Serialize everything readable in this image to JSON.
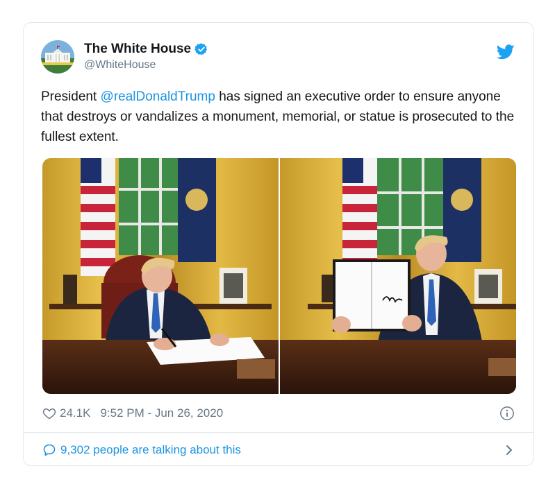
{
  "author": {
    "display_name": "The White House",
    "handle": "@WhiteHouse"
  },
  "tweet": {
    "text_before": "President ",
    "mention": "@realDonaldTrump",
    "text_after": " has signed an executive order to ensure anyone that destroys or vandalizes a monument, memorial, or statue is prosecuted to the fullest extent."
  },
  "meta": {
    "likes": "24.1K",
    "timestamp": "9:52 PM - Jun 26, 2020"
  },
  "conversation": {
    "label": "9,302 people are talking about this"
  },
  "icons": {
    "verified": "verified-badge-icon",
    "brand": "twitter-bird-icon",
    "like": "heart-icon",
    "info": "info-icon",
    "reply": "speech-bubble-icon",
    "more": "chevron-right-icon"
  },
  "colors": {
    "link": "#1b95e0",
    "muted": "#657786",
    "border": "#e1e8ed",
    "text": "#14171a"
  }
}
